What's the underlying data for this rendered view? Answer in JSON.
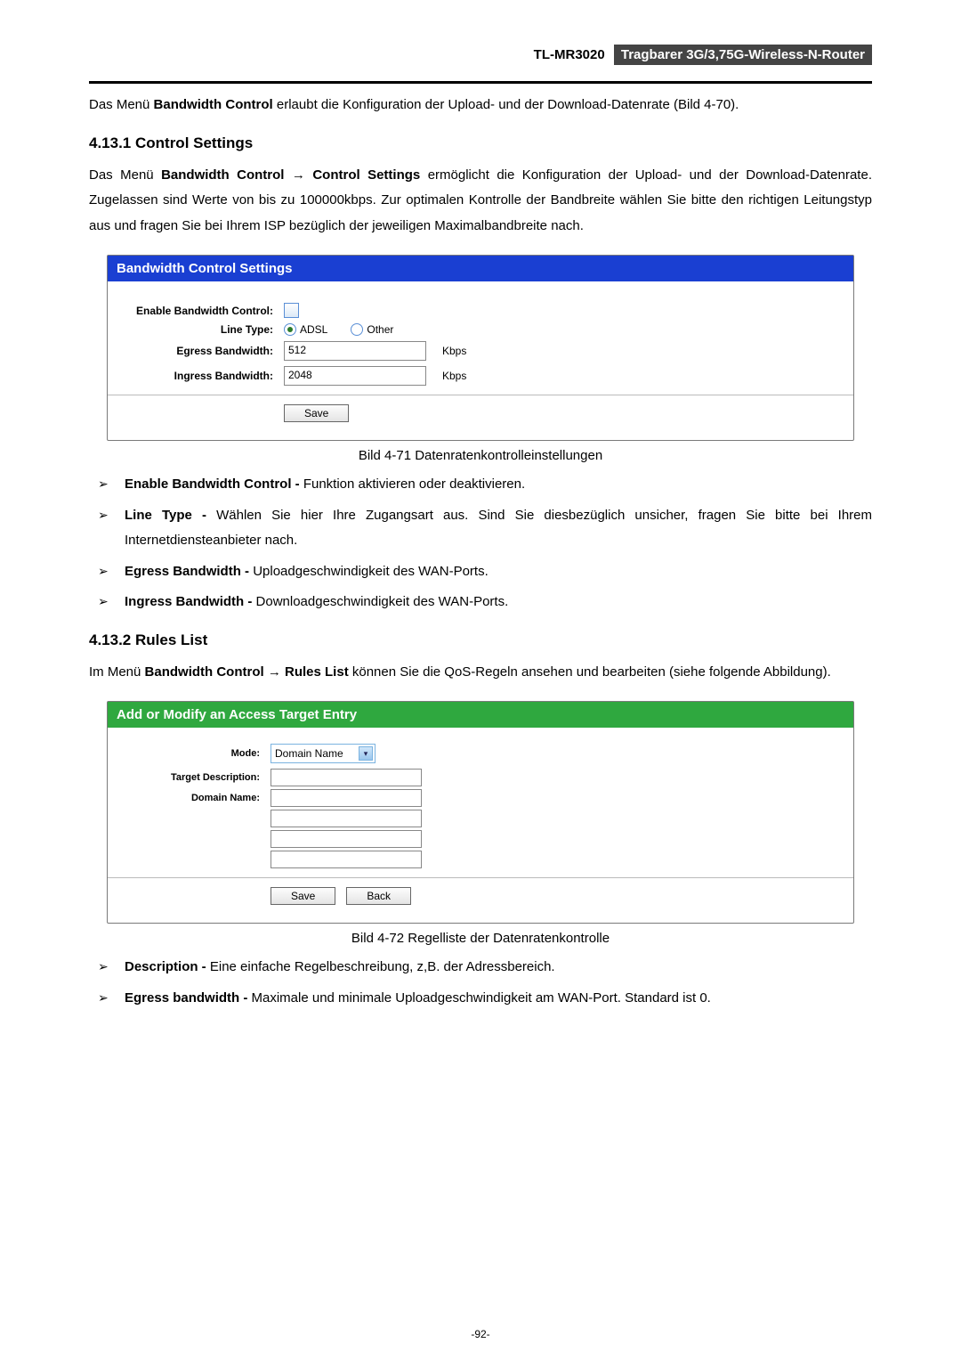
{
  "header": {
    "model": "TL-MR3020",
    "subtitle": "Tragbarer 3G/3,75G-Wireless-N-Router"
  },
  "intro": {
    "line1_pre": "Das Menü ",
    "line1_bold": "Bandwidth Control",
    "line1_post": " erlaubt die Konfiguration der Upload- und der Download-Datenrate (Bild 4-70)."
  },
  "sec1": {
    "heading": "4.13.1  Control Settings",
    "para_pre": "Das Menü ",
    "para_bold": "Bandwidth Control → Control Settings",
    "para_post": " ermöglicht die Konfiguration der Upload- und der Download-Datenrate. Zugelassen sind Werte von bis zu 100000kbps. Zur optimalen Kontrolle der Bandbreite wählen Sie bitte den richtigen Leitungstyp aus und fragen Sie bei Ihrem ISP bezüglich der jeweiligen Maximalbandbreite nach."
  },
  "panel1": {
    "title": "Bandwidth Control Settings",
    "labels": {
      "enable": "Enable Bandwidth Control:",
      "line_type": "Line Type:",
      "egress": "Egress Bandwidth:",
      "ingress": "Ingress Bandwidth:"
    },
    "line_type_options": {
      "adsl": "ADSL",
      "other": "Other"
    },
    "egress_value": "512",
    "ingress_value": "2048",
    "unit": "Kbps",
    "save": "Save"
  },
  "fig1_caption": "Bild 4-71 Datenratenkontrolleinstellungen",
  "list1": [
    {
      "b": "Enable Bandwidth Control - ",
      "t": "Funktion aktivieren oder deaktivieren."
    },
    {
      "b": "Line Type - ",
      "t": "Wählen Sie hier Ihre Zugangsart aus. Sind Sie diesbezüglich unsicher, fragen Sie bitte bei Ihrem Internetdiensteanbieter nach."
    },
    {
      "b": "Egress Bandwidth - ",
      "t": "Uploadgeschwindigkeit des WAN-Ports."
    },
    {
      "b": "Ingress Bandwidth - ",
      "t": "Downloadgeschwindigkeit des WAN-Ports."
    }
  ],
  "sec2": {
    "heading": "4.13.2  Rules List",
    "para_pre": "Im Menü ",
    "para_bold": "Bandwidth Control → Rules List",
    "para_post": " können Sie die QoS-Regeln ansehen und bearbeiten (siehe folgende Abbildung)."
  },
  "panel2": {
    "title": "Add or Modify an Access Target Entry",
    "labels": {
      "mode": "Mode:",
      "target_desc": "Target Description:",
      "domain": "Domain Name:"
    },
    "mode_value": "Domain Name",
    "save": "Save",
    "back": "Back"
  },
  "fig2_caption": "Bild 4-72 Regelliste der Datenratenkontrolle",
  "list2": [
    {
      "b": "Description - ",
      "t": "Eine einfache Regelbeschreibung, z,B. der Adressbereich."
    },
    {
      "b": "Egress bandwidth - ",
      "t": "Maximale und minimale Uploadgeschwindigkeit am WAN-Port. Standard ist 0."
    }
  ],
  "page_number": "-92-"
}
